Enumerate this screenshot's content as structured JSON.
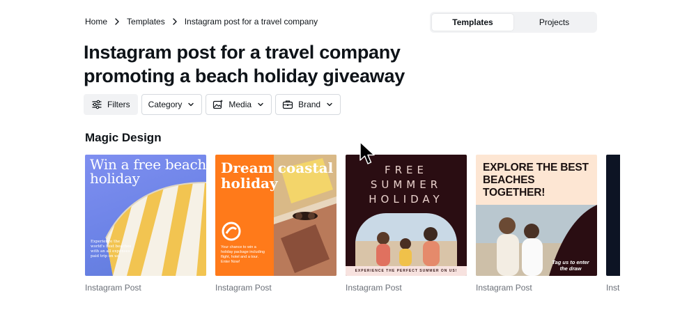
{
  "breadcrumb": {
    "home": "Home",
    "templates": "Templates",
    "current": "Instagram post for a travel company"
  },
  "view_toggle": {
    "templates": "Templates",
    "projects": "Projects",
    "active": "Templates"
  },
  "page": {
    "title": "Instagram post for a travel company promoting a beach holiday giveaway"
  },
  "filters": {
    "filters_label": "Filters",
    "category_label": "Category",
    "media_label": "Media",
    "brand_label": "Brand"
  },
  "section": {
    "title": "Magic Design"
  },
  "cards": [
    {
      "label": "Instagram Post",
      "design_title": "Win a free beach holiday",
      "design_body": "Experience the world's best beaches with an all expenses paid trip on us."
    },
    {
      "label": "Instagram Post",
      "design_title": "Dream coastal holiday",
      "design_body": "Your chance to win a holiday package including flight, hotel and a tour. Enter Now!"
    },
    {
      "label": "Instagram Post",
      "design_title": "FREE SUMMER HOLIDAY",
      "design_strip": "EXPERIENCE THE PERFECT SUMMER ON US!"
    },
    {
      "label": "Instagram Post",
      "design_title": "EXPLORE THE BEST BEACHES TOGETHER!",
      "design_cta": "Tag us to enter the draw"
    },
    {
      "label": "Inst"
    }
  ],
  "colors": {
    "card1_bg": "#6a82e6",
    "card2_bg": "#ff7a1a",
    "card3_bg": "#2a0d12",
    "card4_bg": "#fde6d3",
    "card5_bg": "#0d1424"
  },
  "icons": {
    "breadcrumb_separator": "chevron-right-icon",
    "filters": "sliders-icon",
    "dropdown": "chevron-down-icon",
    "media": "image-sparkle-icon",
    "brand": "briefcase-icon",
    "pointer": "mouse-cursor-icon"
  }
}
